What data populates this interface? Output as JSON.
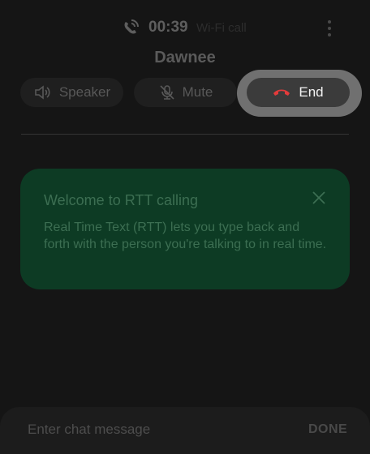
{
  "header": {
    "call_status_icon": "wifi-calling-icon",
    "timer": "00:39",
    "call_type": "Wi-Fi call",
    "more_icon": "more-vertical-icon"
  },
  "caller": {
    "name": "Dawnee"
  },
  "controls": {
    "speaker_label": "Speaker",
    "speaker_icon": "speaker-icon",
    "mute_label": "Mute",
    "mute_icon": "mic-off-icon",
    "end_label": "End",
    "end_icon": "end-call-icon"
  },
  "rtt_card": {
    "title": "Welcome to RTT calling",
    "body": "Real Time Text (RTT) lets you type back and forth with the person you're talking to in real time.",
    "close_icon": "close-icon"
  },
  "chat": {
    "value": "",
    "placeholder": "Enter chat message",
    "done_label": "DONE"
  },
  "colors": {
    "background": "#151515",
    "end_icon_red": "#e23b3b",
    "card_green": "#0d3b24"
  }
}
